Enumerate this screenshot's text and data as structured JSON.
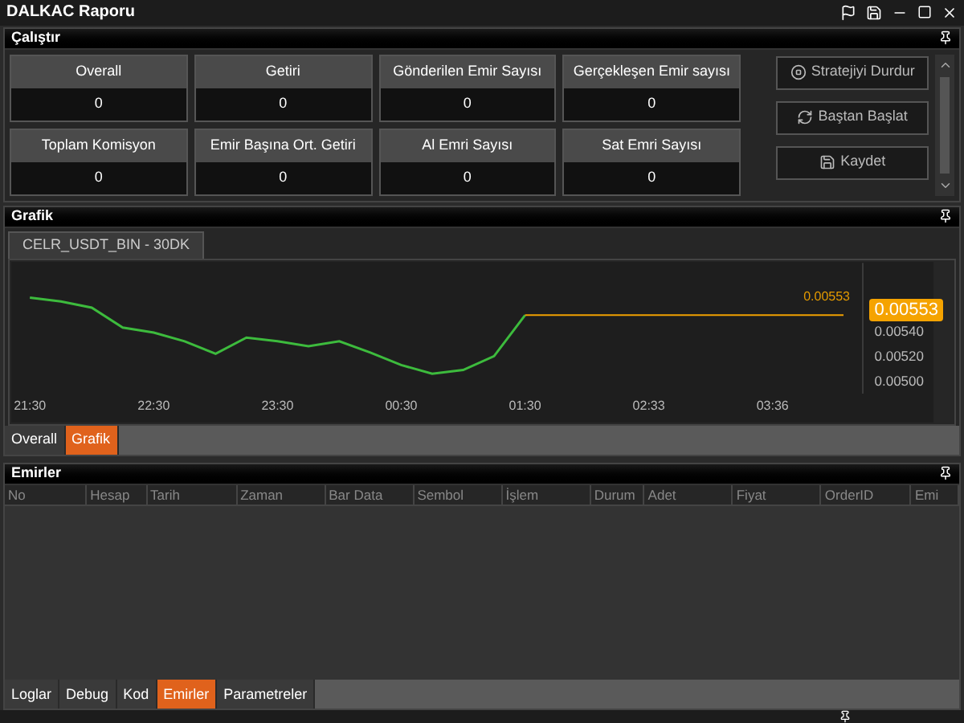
{
  "window": {
    "title": "DALKAC Raporu"
  },
  "run_panel": {
    "title": "Çalıştır",
    "stats": [
      {
        "label": "Overall",
        "value": "0"
      },
      {
        "label": "Getiri",
        "value": "0"
      },
      {
        "label": "Gönderilen Emir Sayısı",
        "value": "0"
      },
      {
        "label": "Gerçekleşen Emir sayısı",
        "value": "0"
      },
      {
        "label": "Toplam Komisyon",
        "value": "0"
      },
      {
        "label": "Emir Başına Ort. Getiri",
        "value": "0"
      },
      {
        "label": "Al Emri Sayısı",
        "value": "0"
      },
      {
        "label": "Sat Emri Sayısı",
        "value": "0"
      }
    ],
    "buttons": [
      {
        "label": "Stratejiyi Durdur",
        "kind": "stop"
      },
      {
        "label": "Baştan Başlat",
        "kind": "restart"
      },
      {
        "label": "Kaydet",
        "kind": "save"
      }
    ]
  },
  "chart_panel": {
    "title": "Grafik",
    "tabs": [
      {
        "label": "CELR_USDT_BIN - 30DK",
        "selected": true
      }
    ],
    "price_axis_label": "0.00553",
    "chart_data": {
      "type": "line",
      "categories": [
        "21:30",
        null,
        null,
        null,
        "22:30",
        null,
        null,
        null,
        "23:30",
        null,
        null,
        null,
        "00:30",
        null,
        null,
        null,
        "01:30",
        null,
        null,
        null,
        "02:33",
        null,
        null,
        null,
        "03:36",
        null,
        null
      ],
      "series": [
        {
          "color": "#3dbb3d",
          "values": [
            0.00567,
            0.00564,
            0.00559,
            0.00543,
            0.00539,
            0.00532,
            0.00522,
            0.00535,
            0.00532,
            0.00528,
            0.00532,
            0.00523,
            0.00513,
            0.00506,
            0.00509,
            0.0052,
            0.00553,
            null,
            null,
            null,
            null,
            null,
            null,
            null,
            null,
            null,
            null
          ]
        }
      ],
      "ylim": [
        0.0049,
        0.00595
      ],
      "yticks": [
        {
          "value": 0.0054,
          "label": "0.00540"
        },
        {
          "value": 0.0052,
          "label": "0.00520"
        },
        {
          "value": 0.005,
          "label": "0.00500"
        }
      ],
      "annotations": [
        "0.00553"
      ]
    },
    "bottom_tabs": [
      {
        "label": "Overall",
        "selected": false
      },
      {
        "label": "Grafik",
        "selected": true
      }
    ]
  },
  "orders_panel": {
    "title": "Emirler",
    "columns": [
      "No",
      "Hesap",
      "Tarih",
      "Zaman",
      "Bar Data",
      "Sembol",
      "İşlem",
      "Durum",
      "Adet",
      "Fiyat",
      "OrderID",
      "Emi"
    ],
    "bottom_tabs": [
      {
        "label": "Loglar",
        "selected": false
      },
      {
        "label": "Debug",
        "selected": false
      },
      {
        "label": "Kod",
        "selected": false
      },
      {
        "label": "Emirler",
        "selected": true
      },
      {
        "label": "Parametreler",
        "selected": false
      }
    ]
  }
}
